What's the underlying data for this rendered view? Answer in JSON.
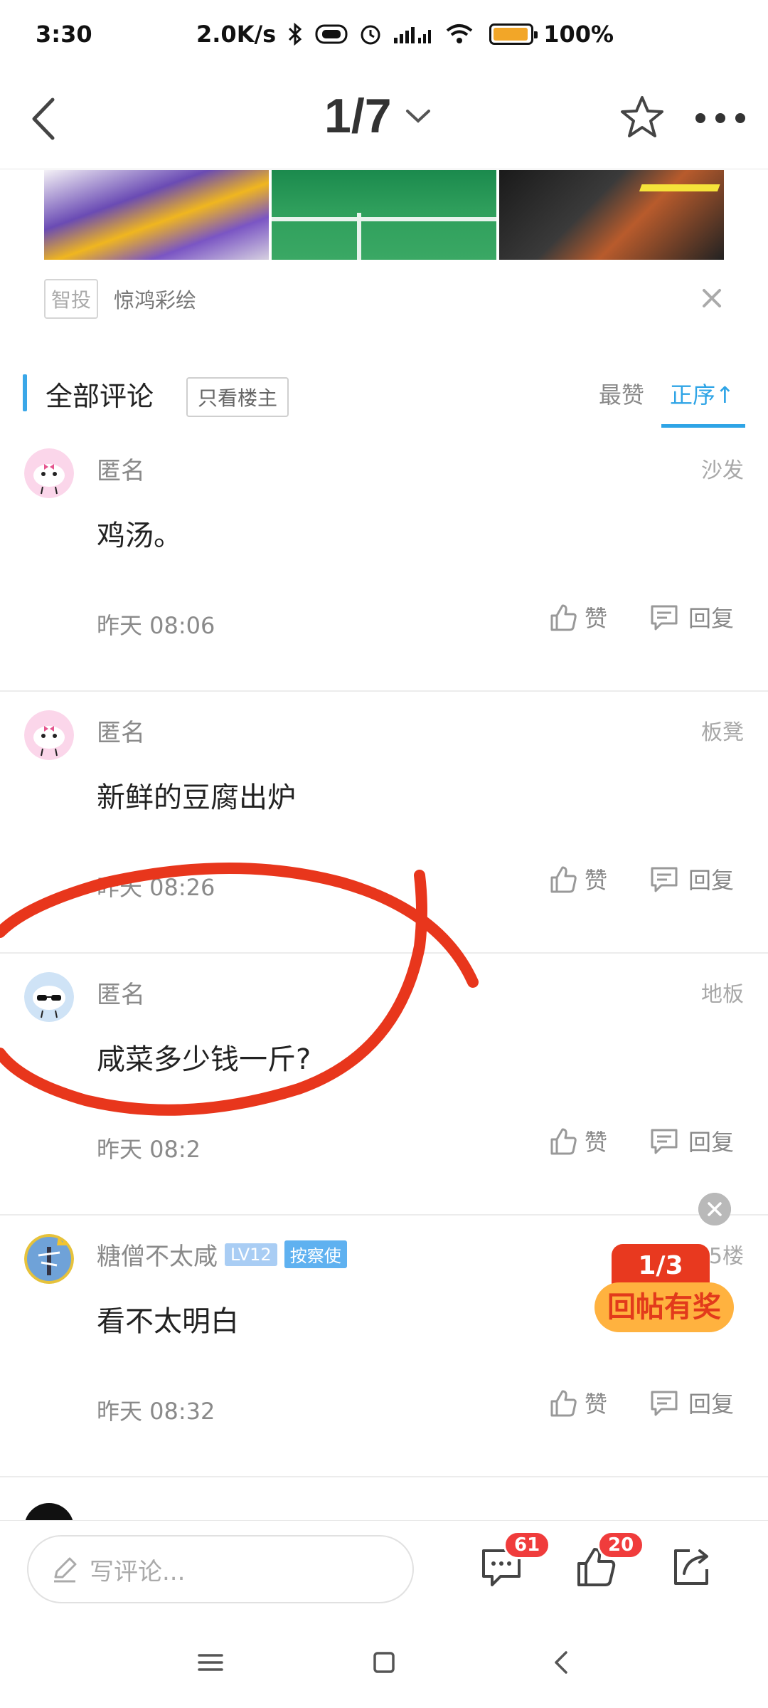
{
  "status_bar": {
    "time": "3:30",
    "network_speed": "2.0K/s",
    "battery": "100%"
  },
  "topnav": {
    "page_indicator": "1/7"
  },
  "ad": {
    "tag": "智投",
    "name": "惊鸿彩绘"
  },
  "comments_header": {
    "title": "全部评论",
    "filter": "只看楼主",
    "sort_like": "最赞",
    "sort_order": "正序↑"
  },
  "comments": [
    {
      "user": "匿名",
      "floor": "沙发",
      "text": "鸡汤。",
      "time": "昨天 08:06",
      "like": "赞",
      "reply": "回复"
    },
    {
      "user": "匿名",
      "floor": "板凳",
      "text": "新鲜的豆腐出炉",
      "time": "昨天 08:26",
      "like": "赞",
      "reply": "回复"
    },
    {
      "user": "匿名",
      "floor": "地板",
      "text": "咸菜多少钱一斤?",
      "time": "昨天 08:2",
      "like": "赞",
      "reply": "回复"
    },
    {
      "user": "糖僧不太咸",
      "level": "LV12",
      "role": "按察使",
      "floor": "5楼",
      "text": "看不太明白",
      "time": "昨天 08:32",
      "like": "赞",
      "reply": "回复"
    }
  ],
  "reward": {
    "top": "1/3",
    "bottom": "回帖有奖"
  },
  "bottom_bar": {
    "input_placeholder": "写评论...",
    "comment_count": "61",
    "like_count": "20"
  },
  "colors": {
    "accent": "#2ea4e6",
    "scribble": "#e8361c",
    "badge": "#f03c3c"
  }
}
